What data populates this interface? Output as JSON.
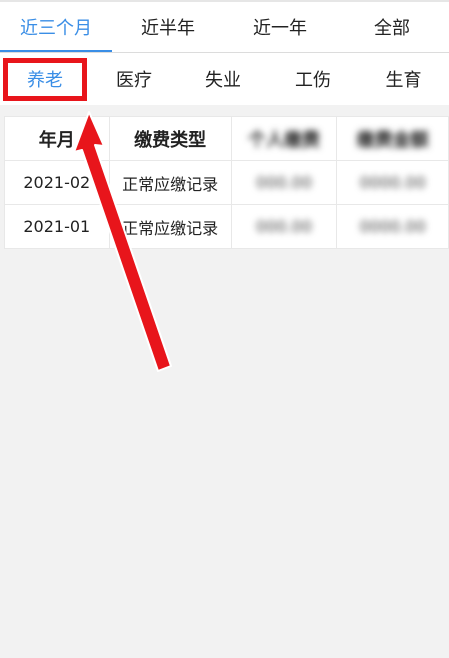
{
  "period_tabs": [
    {
      "label": "近三个月",
      "active": true
    },
    {
      "label": "近半年",
      "active": false
    },
    {
      "label": "近一年",
      "active": false
    },
    {
      "label": "全部",
      "active": false
    }
  ],
  "insurance_tabs": [
    {
      "label": "养老",
      "active": true
    },
    {
      "label": "医疗",
      "active": false
    },
    {
      "label": "失业",
      "active": false
    },
    {
      "label": "工伤",
      "active": false
    },
    {
      "label": "生育",
      "active": false
    }
  ],
  "table": {
    "headers": [
      "年月",
      "缴费类型",
      "个人缴费",
      "缴费金额"
    ],
    "rows": [
      [
        "2021-02",
        "正常应缴记录",
        "000.00",
        "0000.00"
      ],
      [
        "2021-01",
        "正常应缴记录",
        "000.00",
        "0000.00"
      ]
    ]
  },
  "colors": {
    "accent": "#3a8ee6",
    "annotation": "#e8151b",
    "background": "#f2f2f2"
  }
}
